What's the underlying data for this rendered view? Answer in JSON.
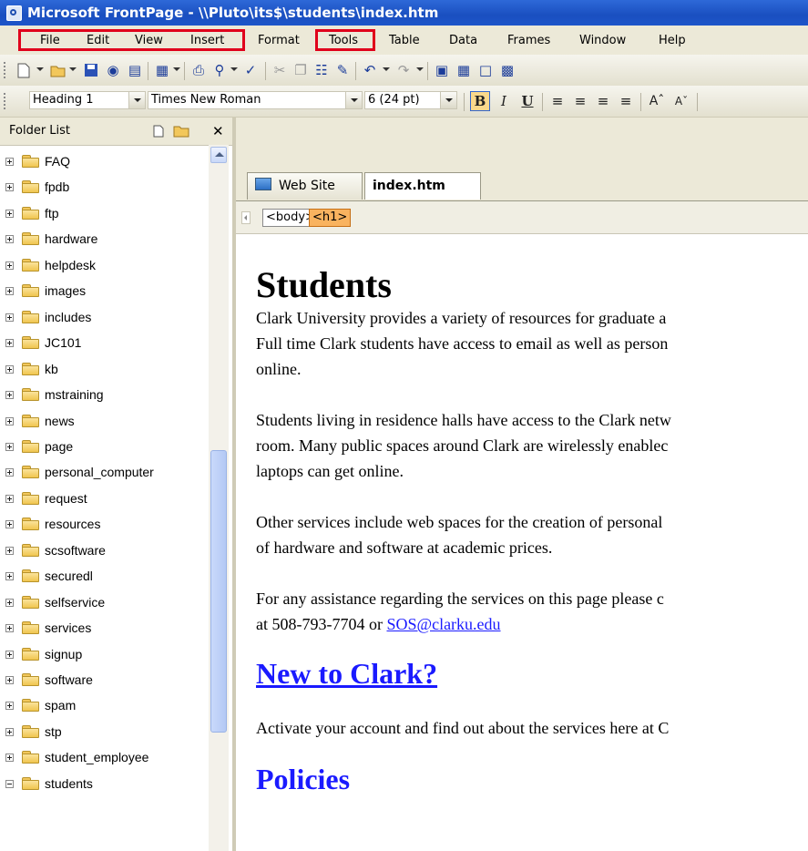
{
  "window": {
    "title": "Microsoft FrontPage - \\\\Pluto\\its$\\students\\index.htm"
  },
  "menubar": {
    "items": [
      {
        "label": "File"
      },
      {
        "label": "Edit"
      },
      {
        "label": "View"
      },
      {
        "label": "Insert"
      },
      {
        "label": "Format"
      },
      {
        "label": "Tools"
      },
      {
        "label": "Table"
      },
      {
        "label": "Data"
      },
      {
        "label": "Frames"
      },
      {
        "label": "Window"
      },
      {
        "label": "Help"
      }
    ]
  },
  "format_toolbar": {
    "style": "Heading 1",
    "font": "Times New Roman",
    "size": "6  (24 pt)",
    "bold": "B",
    "italic": "I",
    "underline": "U"
  },
  "folder_list": {
    "title": "Folder List",
    "items": [
      {
        "label": "FAQ",
        "expanded": false
      },
      {
        "label": "fpdb",
        "expanded": false
      },
      {
        "label": "ftp",
        "expanded": false
      },
      {
        "label": "hardware",
        "expanded": false
      },
      {
        "label": "helpdesk",
        "expanded": false
      },
      {
        "label": "images",
        "expanded": false
      },
      {
        "label": "includes",
        "expanded": false
      },
      {
        "label": "JC101",
        "expanded": false
      },
      {
        "label": "kb",
        "expanded": false
      },
      {
        "label": "mstraining",
        "expanded": false
      },
      {
        "label": "news",
        "expanded": false
      },
      {
        "label": "page",
        "expanded": false
      },
      {
        "label": "personal_computer",
        "expanded": false
      },
      {
        "label": "request",
        "expanded": false
      },
      {
        "label": "resources",
        "expanded": false
      },
      {
        "label": "scsoftware",
        "expanded": false
      },
      {
        "label": "securedl",
        "expanded": false
      },
      {
        "label": "selfservice",
        "expanded": false
      },
      {
        "label": "services",
        "expanded": false
      },
      {
        "label": "signup",
        "expanded": false
      },
      {
        "label": "software",
        "expanded": false
      },
      {
        "label": "spam",
        "expanded": false
      },
      {
        "label": "stp",
        "expanded": false
      },
      {
        "label": "student_employee",
        "expanded": false
      },
      {
        "label": "students",
        "expanded": true
      }
    ]
  },
  "editor": {
    "tabs": [
      {
        "label": "Web Site"
      },
      {
        "label": "index.htm"
      }
    ],
    "tag_path": [
      {
        "label": "<body>"
      },
      {
        "label": "<h1>"
      }
    ],
    "page": {
      "heading": "Students",
      "para1_line1": "Clark University provides a variety of resources for graduate a",
      "para1_line2": "Full time Clark students have access to email as well as person",
      "para1_line3": "online.",
      "para2_line1": "Students living in residence halls have access to the Clark netw",
      "para2_line2": "room. Many public spaces around Clark are wirelessly enablec",
      "para2_line3": "laptops can get online.",
      "para3_line1": "Other services include web spaces for the creation of personal",
      "para3_line2": "of hardware and software at academic prices.",
      "para4_line1": "For any assistance regarding the services on this page please c",
      "para4_line2_prefix": "at 508-793-7704 or ",
      "para4_email": "SOS@clarku.edu",
      "new_heading": "New to Clark?",
      "new_text": "Activate your account and find out about the services here at C",
      "policies_heading": "Policies"
    }
  },
  "colors": {
    "title_bar": "#1f55c8",
    "highlight_box": "#e0001b",
    "link": "#1a1aff",
    "active_tag": "#f9b35f"
  }
}
